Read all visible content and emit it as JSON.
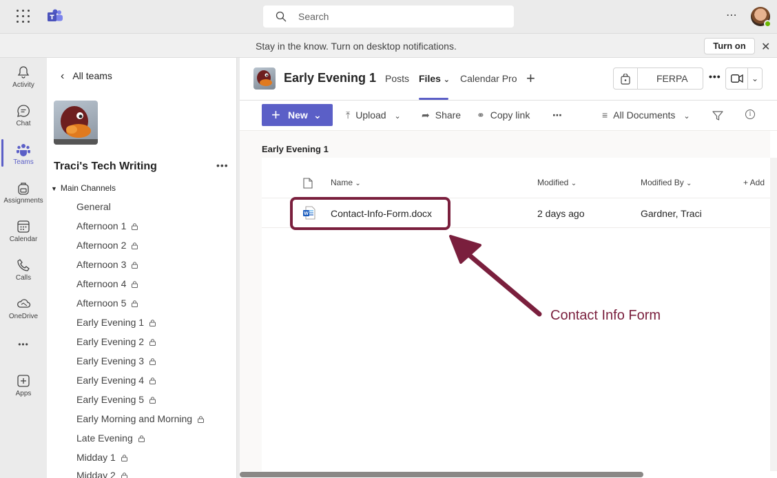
{
  "topbar": {
    "search_placeholder": "Search",
    "more": "⋯"
  },
  "notification": {
    "text": "Stay in the know. Turn on desktop notifications.",
    "button": "Turn on",
    "close": "✕"
  },
  "rail": {
    "items": [
      {
        "label": "Activity",
        "icon": "bell-icon"
      },
      {
        "label": "Chat",
        "icon": "chat-icon"
      },
      {
        "label": "Teams",
        "icon": "teams-icon",
        "active": true
      },
      {
        "label": "Assignments",
        "icon": "backpack-icon"
      },
      {
        "label": "Calendar",
        "icon": "calendar-icon"
      },
      {
        "label": "Calls",
        "icon": "phone-icon"
      },
      {
        "label": "OneDrive",
        "icon": "cloud-icon"
      },
      {
        "label": "Apps",
        "icon": "apps-icon"
      }
    ],
    "more": "•••"
  },
  "panel": {
    "back_label": "All teams",
    "team_name": "Traci's Tech Writing",
    "team_more": "•••",
    "section": "Main Channels",
    "channels": [
      {
        "name": "General",
        "locked": false
      },
      {
        "name": "Afternoon 1",
        "locked": true
      },
      {
        "name": "Afternoon 2",
        "locked": true
      },
      {
        "name": "Afternoon 3",
        "locked": true
      },
      {
        "name": "Afternoon 4",
        "locked": true
      },
      {
        "name": "Afternoon 5",
        "locked": true
      },
      {
        "name": "Early Evening 1",
        "locked": true
      },
      {
        "name": "Early Evening 2",
        "locked": true
      },
      {
        "name": "Early Evening 3",
        "locked": true
      },
      {
        "name": "Early Evening 4",
        "locked": true
      },
      {
        "name": "Early Evening 5",
        "locked": true
      },
      {
        "name": "Early Morning and Morning",
        "locked": true
      },
      {
        "name": "Late Evening",
        "locked": true
      },
      {
        "name": "Midday 1",
        "locked": true
      },
      {
        "name": "Midday 2",
        "locked": true
      }
    ]
  },
  "channel_header": {
    "title": "Early Evening 1",
    "tabs": [
      "Posts",
      "Files",
      "Calendar Pro"
    ],
    "active_tab": "Files",
    "ferpa": "FERPA",
    "more": "•••"
  },
  "commands": {
    "new": "New",
    "upload": "Upload",
    "share": "Share",
    "copy_link": "Copy link",
    "more": "⋯",
    "view": "All Documents"
  },
  "library": {
    "heading": "Early Evening 1",
    "columns": {
      "name": "Name",
      "modified": "Modified",
      "modified_by": "Modified By",
      "add": "+ Add"
    },
    "files": [
      {
        "name": "Contact-Info-Form.docx",
        "modified": "2 days ago",
        "modified_by": "Gardner, Traci",
        "type": "word"
      }
    ]
  },
  "annotation": {
    "callout": "Contact Info Form",
    "color": "#7a1f3d"
  },
  "colors": {
    "accent": "#5b5fc7"
  }
}
